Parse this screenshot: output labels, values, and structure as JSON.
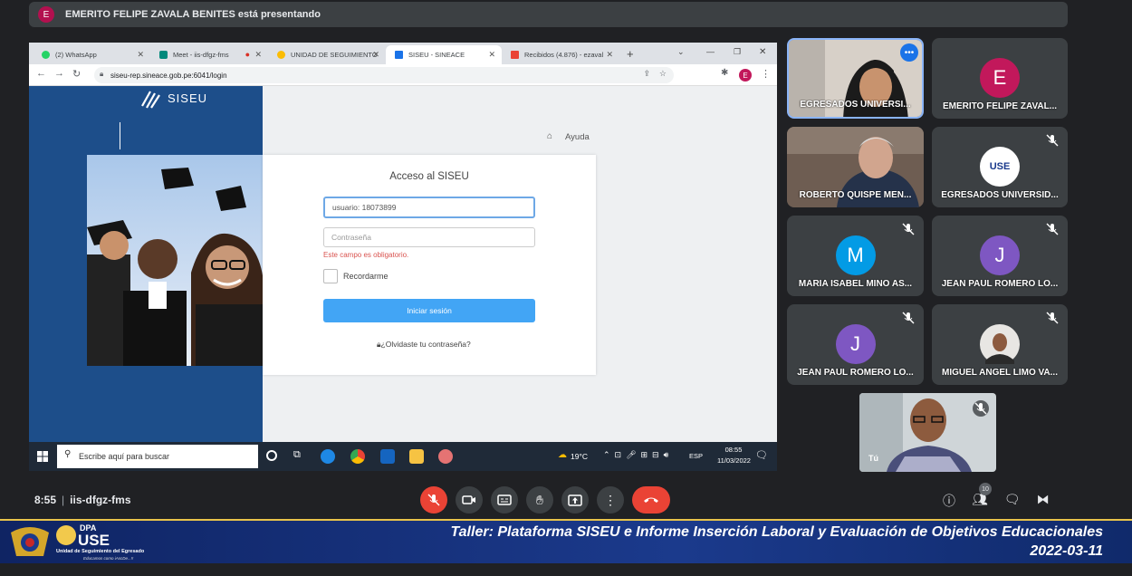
{
  "meet": {
    "presenting_banner": "EMERITO FELIPE ZAVALA BENITES está presentando",
    "presenter_initial": "E",
    "time": "8:55",
    "separator": "|",
    "meeting_code": "iis-dfgz-fms",
    "people_count": "10"
  },
  "browser": {
    "tabs": [
      {
        "label": "(2) WhatsApp",
        "color": "#25d366"
      },
      {
        "label": "Meet - iis-dfgz-fms",
        "color": "#00897b"
      },
      {
        "label": "UNIDAD DE SEGUIMIENTO",
        "color": "#fbbc04"
      },
      {
        "label": "SISEU - SINEACE",
        "color": "#1a73e8"
      },
      {
        "label": "Recibidos (4.876) - ezaval",
        "color": "#ea4335"
      }
    ],
    "url": "siseu-rep.sineace.gob.pe:6041/login",
    "new_tab": "+",
    "profile_initial": "E"
  },
  "siseu": {
    "logo": "SISEU",
    "help": "Ayuda",
    "login_title": "Acceso al SISEU",
    "username_value": "usuario: 18073899",
    "password_placeholder": "Contraseña",
    "error": "Este campo es obligatorio.",
    "remember": "Recordarme",
    "submit": "Iniciar sesión",
    "forgot": "¿Olvidaste tu contraseña?"
  },
  "taskbar": {
    "search": "Escribe aquí para buscar",
    "weather": "19°C",
    "lang": "ESP",
    "time": "08:55",
    "date": "11/03/2022"
  },
  "participants": [
    {
      "name": "EGRESADOS UNIVERSI...",
      "kind": "video"
    },
    {
      "name": "EMERITO FELIPE ZAVAL...",
      "initial": "E",
      "color": "#c2185b"
    },
    {
      "name": "ROBERTO QUISPE MEN...",
      "kind": "video"
    },
    {
      "name": "EGRESADOS UNIVERSID...",
      "kind": "logo",
      "logo_text": "USE"
    },
    {
      "name": "MARIA ISABEL MINO AS...",
      "initial": "M",
      "color": "#039be5"
    },
    {
      "name": "JEAN PAUL ROMERO LO...",
      "initial": "J",
      "color": "#7e57c2"
    },
    {
      "name": "JEAN PAUL ROMERO LO...",
      "initial": "J",
      "color": "#7e57c2"
    },
    {
      "name": "MIGUEL ANGEL LIMO VA...",
      "kind": "photo"
    }
  ],
  "self_view": {
    "label": "Tú"
  },
  "footer": {
    "logo_dpa": "DPA",
    "logo_use": "USE",
    "logo_caption": "Unidad de Seguimiento del Egresado",
    "logo_tagline": "Educamos como iAscDe...!!",
    "title": "Taller: Plataforma SISEU e Informe Inserción Laboral y Evaluación de Objetivos Educacionales",
    "date": "2022-03-11"
  }
}
